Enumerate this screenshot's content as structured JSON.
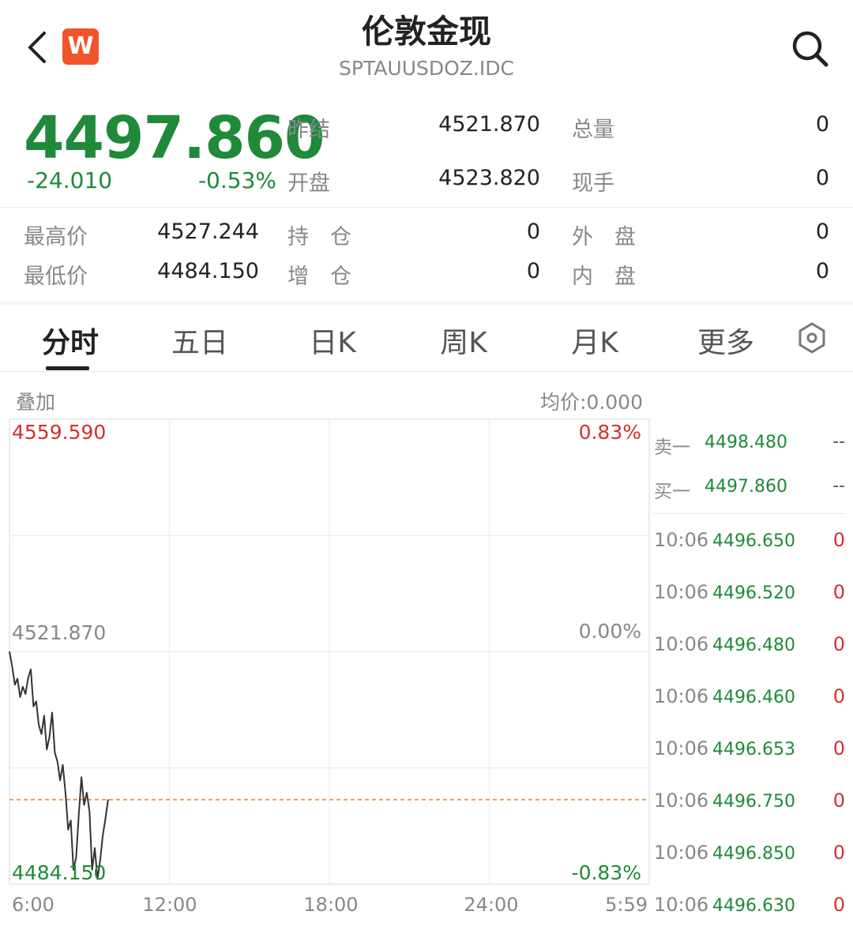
{
  "header": {
    "title": "伦敦金现",
    "subtitle": "SPTAUUSDOZ.IDC",
    "logo_letter": "W"
  },
  "quote": {
    "last_price": "4497.860",
    "change": "-24.010",
    "change_pct": "-0.53%",
    "prev_settle_label": "昨结",
    "prev_settle": "4521.870",
    "open_label": "开盘",
    "open": "4523.820",
    "total_volume_label": "总量",
    "total_volume": "0",
    "current_hand_label": "现手",
    "current_hand": "0",
    "high_label": "最高价",
    "high": "4527.244",
    "low_label": "最低价",
    "low": "4484.150",
    "open_interest_label": "持　仓",
    "open_interest": "0",
    "oi_change_label": "增　仓",
    "oi_change": "0",
    "outer_label": "外　盘",
    "outer": "0",
    "inner_label": "内　盘",
    "inner": "0"
  },
  "tabs": [
    "分时",
    "五日",
    "日K",
    "周K",
    "月K",
    "更多"
  ],
  "active_tab": 0,
  "chart": {
    "overlay_label": "叠加",
    "avg_price_label": "均价:0.000",
    "y_top": "4559.590",
    "y_mid": "4521.870",
    "y_bottom": "4484.150",
    "pct_top": "0.83%",
    "pct_mid": "0.00%",
    "pct_bottom": "-0.83%",
    "x_labels": [
      "6:00",
      "12:00",
      "18:00",
      "24:00",
      "5:59"
    ]
  },
  "chart_data": {
    "type": "line",
    "title": "",
    "xlabel": "",
    "ylabel": "",
    "ylim": [
      4484.15,
      4559.59
    ],
    "xlim_hours": [
      0,
      24
    ],
    "reference_line": 4521.87,
    "current_price_line": 4497.86,
    "x_hours": [
      0,
      0.1,
      0.2,
      0.3,
      0.4,
      0.5,
      0.6,
      0.7,
      0.8,
      0.9,
      1.0,
      1.1,
      1.2,
      1.3,
      1.4,
      1.5,
      1.6,
      1.7,
      1.8,
      1.9,
      2.0,
      2.1,
      2.2,
      2.3,
      2.4,
      2.5,
      2.6,
      2.7,
      2.8,
      2.9,
      3.0,
      3.1,
      3.2,
      3.3,
      3.4,
      3.5,
      3.6,
      3.7,
      3.8,
      3.9,
      4.0
    ],
    "y": [
      4521.9,
      4519.5,
      4516.5,
      4517.5,
      4514.5,
      4516.2,
      4515.0,
      4517.6,
      4519.0,
      4513.0,
      4513.8,
      4510.0,
      4508.5,
      4511.5,
      4506.0,
      4508.0,
      4512.0,
      4505.5,
      4504.0,
      4501.0,
      4503.5,
      4499.0,
      4493.0,
      4494.5,
      4486.5,
      4488.5,
      4495.5,
      4501.5,
      4497.0,
      4499.0,
      4496.0,
      4486.5,
      4490.0,
      4485.0,
      4488.0,
      4492.0,
      4494.8,
      4497.9
    ],
    "series": [
      {
        "name": "",
        "values": []
      }
    ]
  },
  "order_book": {
    "ask1_label": "卖一",
    "ask1_price": "4498.480",
    "ask1_vol": "--",
    "bid1_label": "买一",
    "bid1_price": "4497.860",
    "bid1_vol": "--"
  },
  "ticks": [
    {
      "time": "10:06",
      "price": "4496.650",
      "vol": "0"
    },
    {
      "time": "10:06",
      "price": "4496.520",
      "vol": "0"
    },
    {
      "time": "10:06",
      "price": "4496.480",
      "vol": "0"
    },
    {
      "time": "10:06",
      "price": "4496.460",
      "vol": "0"
    },
    {
      "time": "10:06",
      "price": "4496.653",
      "vol": "0"
    },
    {
      "time": "10:06",
      "price": "4496.750",
      "vol": "0"
    },
    {
      "time": "10:06",
      "price": "4496.850",
      "vol": "0"
    },
    {
      "time": "10:06",
      "price": "4496.630",
      "vol": "0"
    }
  ],
  "colors": {
    "down": "#1f8a3a",
    "up": "#d23030",
    "price_line": "#333333",
    "current_dash": "#f08a2c"
  },
  "icons": [
    "back-arrow-icon",
    "search-icon",
    "settings-hexagon-icon"
  ]
}
